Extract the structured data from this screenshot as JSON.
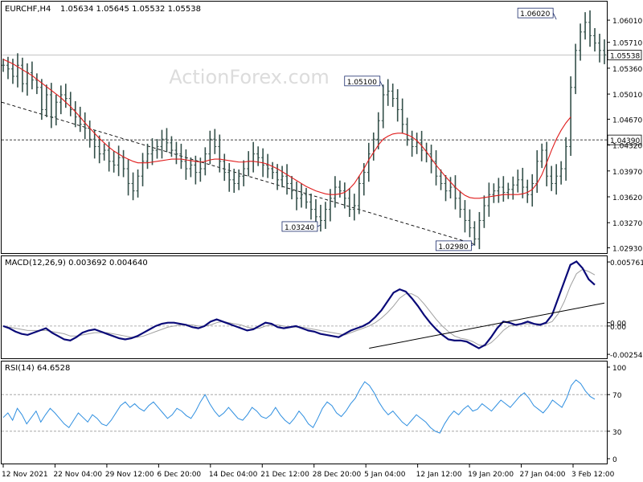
{
  "header": {
    "symbol": "EURCHF,H4",
    "ohlc": "1.05634 1.05645 1.05532 1.05538"
  },
  "watermark": "ActionForex.com",
  "colors": {
    "bars": "#34504a",
    "ma": "#e01c1c",
    "macd": "#0a0a78",
    "signal": "#a0a0a0",
    "rsi": "#2f8fe0",
    "trendline": "#000000",
    "text": "#000000"
  },
  "chart_data": [
    {
      "type": "line",
      "panel": "price",
      "ylim": [
        1.0287,
        1.0625
      ],
      "y_ticks": [
        "1.06010",
        "1.05710",
        "1.05360",
        "1.05010",
        "1.04670",
        "1.04320",
        "1.03970",
        "1.03620",
        "1.03270",
        "1.02930"
      ],
      "x_tick_labels": [
        "12 Nov 2021",
        "22 Nov 04:00",
        "29 Nov 12:00",
        "6 Dec 20:00",
        "14 Dec 04:00",
        "21 Dec 12:00",
        "28 Dec 20:00",
        "5 Jan 04:00",
        "12 Jan 12:00",
        "19 Jan 20:00",
        "27 Jan 04:00",
        "3 Feb 12:00"
      ],
      "current_price_label": "1.05538",
      "horizontal_line_label": "1.04390",
      "annotations": [
        {
          "text": "1.03240",
          "bar": 66,
          "value": 1.0324
        },
        {
          "text": "1.05100",
          "bar": 79,
          "value": 1.051
        },
        {
          "text": "1.02980",
          "bar": 98,
          "value": 1.0298
        },
        {
          "text": "1.06020",
          "bar": 115,
          "value": 1.0602
        }
      ],
      "price_series": [
        1.054,
        1.0535,
        1.0525,
        1.054,
        1.0515,
        1.053,
        1.052,
        1.051,
        1.048,
        1.05,
        1.047,
        1.049,
        1.05,
        1.0495,
        1.048,
        1.047,
        1.046,
        1.0455,
        1.044,
        1.043,
        1.042,
        1.0425,
        1.041,
        1.0405,
        1.0415,
        1.04,
        1.038,
        1.037,
        1.039,
        1.041,
        1.042,
        1.0425,
        1.043,
        1.044,
        1.0435,
        1.0425,
        1.042,
        1.041,
        1.04,
        1.0405,
        1.0395,
        1.04,
        1.042,
        1.044,
        1.043,
        1.041,
        1.0395,
        1.0385,
        1.038,
        1.039,
        1.04,
        1.041,
        1.042,
        1.0415,
        1.0405,
        1.04,
        1.0395,
        1.0385,
        1.039,
        1.038,
        1.037,
        1.036,
        1.0365,
        1.0355,
        1.0345,
        1.0335,
        1.033,
        1.0345,
        1.036,
        1.0375,
        1.037,
        1.036,
        1.0345,
        1.035,
        1.038,
        1.0395,
        1.042,
        1.044,
        1.0465,
        1.05,
        1.0505,
        1.0495,
        1.048,
        1.046,
        1.044,
        1.043,
        1.0435,
        1.0425,
        1.042,
        1.041,
        1.039,
        1.038,
        1.037,
        1.0375,
        1.036,
        1.0345,
        1.033,
        1.032,
        1.0305,
        1.033,
        1.035,
        1.0365,
        1.037,
        1.0375,
        1.0368,
        1.0372,
        1.0378,
        1.0385,
        1.0375,
        1.0365,
        1.038,
        1.041,
        1.0425,
        1.039,
        1.038,
        1.039,
        1.04,
        1.043,
        1.051,
        1.056,
        1.0585,
        1.0598,
        1.058,
        1.057,
        1.056,
        1.0554
      ],
      "ma_series": [
        1.0548,
        1.0545,
        1.0542,
        1.0538,
        1.0534,
        1.053,
        1.0526,
        1.0521,
        1.0516,
        1.0511,
        1.0506,
        1.0501,
        1.0496,
        1.049,
        1.0484,
        1.0477,
        1.047,
        1.0462,
        1.0455,
        1.0448,
        1.0441,
        1.0435,
        1.0429,
        1.0424,
        1.042,
        1.0416,
        1.0413,
        1.041,
        1.0408,
        1.0408,
        1.0408,
        1.0409,
        1.041,
        1.0411,
        1.0412,
        1.0413,
        1.0413,
        1.0413,
        1.0412,
        1.0411,
        1.041,
        1.0409,
        1.041,
        1.0412,
        1.0413,
        1.0413,
        1.0412,
        1.0411,
        1.041,
        1.0409,
        1.0409,
        1.041,
        1.041,
        1.0409,
        1.0408,
        1.0406,
        1.0403,
        1.04,
        1.0396,
        1.0392,
        1.0388,
        1.0384,
        1.038,
        1.0376,
        1.0373,
        1.037,
        1.0368,
        1.0366,
        1.0365,
        1.0365,
        1.0366,
        1.0368,
        1.0373,
        1.038,
        1.039,
        1.04,
        1.0412,
        1.0422,
        1.0432,
        1.044,
        1.0444,
        1.0447,
        1.0448,
        1.0448,
        1.0446,
        1.0443,
        1.0438,
        1.0431,
        1.0423,
        1.0414,
        1.0405,
        1.0397,
        1.0389,
        1.0382,
        1.0375,
        1.0369,
        1.0364,
        1.0361,
        1.036,
        1.036,
        1.0361,
        1.0362,
        1.0363,
        1.0364,
        1.0365,
        1.0365,
        1.0365,
        1.0365,
        1.0366,
        1.0368,
        1.0372,
        1.038,
        1.0392,
        1.0408,
        1.0425,
        1.044,
        1.0452,
        1.0462,
        1.047
      ]
    },
    {
      "type": "line",
      "panel": "macd",
      "title": "MACD(12,26,9) 0.003692 0.004640",
      "ylim": [
        -0.0029,
        0.0062
      ],
      "y_ticks": [
        "0.005761",
        "0.00",
        "0.00",
        "-0.002546"
      ],
      "macd_series": [
        0.0,
        -0.0002,
        -0.0005,
        -0.0007,
        -0.0008,
        -0.0006,
        -0.0004,
        -0.0002,
        -0.0006,
        -0.0009,
        -0.0012,
        -0.0013,
        -0.001,
        -0.0006,
        -0.0004,
        -0.0003,
        -0.0005,
        -0.0007,
        -0.0009,
        -0.0011,
        -0.0012,
        -0.0011,
        -0.0009,
        -0.0006,
        -0.0003,
        0.0,
        0.0002,
        0.0003,
        0.0003,
        0.0002,
        0.0001,
        -0.0001,
        -0.0002,
        0.0,
        0.0004,
        0.0006,
        0.0004,
        0.0002,
        0.0,
        -0.0002,
        -0.0004,
        -0.0003,
        0.0,
        0.0003,
        0.0002,
        -0.0001,
        -0.0002,
        -0.0001,
        0.0,
        -0.0002,
        -0.0004,
        -0.0005,
        -0.0007,
        -0.0008,
        -0.0009,
        -0.001,
        -0.0007,
        -0.0004,
        -0.0002,
        0.0,
        0.0003,
        0.0008,
        0.0014,
        0.0022,
        0.003,
        0.0033,
        0.0031,
        0.0025,
        0.0018,
        0.001,
        0.0003,
        -0.0003,
        -0.0008,
        -0.0012,
        -0.0013,
        -0.0013,
        -0.0014,
        -0.0017,
        -0.002,
        -0.0017,
        -0.001,
        -0.0002,
        0.0004,
        0.0003,
        0.0001,
        0.0002,
        0.0004,
        0.0002,
        0.0001,
        0.0003,
        0.001,
        0.0025,
        0.004,
        0.0055,
        0.0058,
        0.0052,
        0.0042,
        0.0037
      ],
      "signal_series": [
        0.0,
        -0.0001,
        -0.0002,
        -0.0003,
        -0.0004,
        -0.0004,
        -0.0004,
        -0.0004,
        -0.0005,
        -0.0006,
        -0.0007,
        -0.0009,
        -0.0009,
        -0.0008,
        -0.0007,
        -0.0006,
        -0.0006,
        -0.0006,
        -0.0007,
        -0.0008,
        -0.0009,
        -0.001,
        -0.001,
        -0.0009,
        -0.0007,
        -0.0005,
        -0.0003,
        -0.0001,
        0.0,
        0.0001,
        0.0001,
        0.0001,
        0.0,
        0.0,
        0.0001,
        0.0003,
        0.0004,
        0.0003,
        0.0002,
        0.0001,
        -0.0001,
        -0.0002,
        -0.0002,
        0.0,
        0.0001,
        0.0001,
        0.0,
        -0.0001,
        -0.0001,
        -0.0001,
        -0.0002,
        -0.0003,
        -0.0004,
        -0.0005,
        -0.0006,
        -0.0007,
        -0.0008,
        -0.0006,
        -0.0004,
        -0.0002,
        0.0,
        0.0003,
        0.0007,
        0.0012,
        0.0018,
        0.0025,
        0.0029,
        0.0029,
        0.0026,
        0.002,
        0.0013,
        0.0006,
        0.0,
        -0.0005,
        -0.0009,
        -0.0011,
        -0.0012,
        -0.0014,
        -0.0017,
        -0.0018,
        -0.0015,
        -0.001,
        -0.0004,
        0.0,
        0.0001,
        0.0002,
        0.0002,
        0.0002,
        0.0002,
        0.0002,
        0.0004,
        0.0011,
        0.0022,
        0.0036,
        0.0047,
        0.0051,
        0.0049,
        0.0046
      ],
      "trendline": [
        {
          "index": 60,
          "value": -0.002
        },
        {
          "index": 99,
          "value": 0.0012
        }
      ]
    },
    {
      "type": "line",
      "panel": "rsi",
      "title": "RSI(14) 64.6528",
      "ylim": [
        0,
        100
      ],
      "y_ticks": [
        "100",
        "70",
        "30",
        "0"
      ],
      "levels": [
        70,
        30
      ],
      "rsi_series": [
        45,
        50,
        42,
        55,
        48,
        38,
        45,
        52,
        40,
        48,
        55,
        50,
        44,
        38,
        34,
        42,
        50,
        45,
        40,
        48,
        44,
        38,
        36,
        42,
        50,
        58,
        62,
        56,
        60,
        55,
        52,
        58,
        62,
        56,
        50,
        44,
        48,
        55,
        52,
        47,
        44,
        52,
        62,
        70,
        60,
        52,
        46,
        50,
        56,
        50,
        44,
        42,
        48,
        56,
        52,
        46,
        44,
        48,
        56,
        48,
        42,
        38,
        44,
        52,
        46,
        38,
        34,
        44,
        55,
        62,
        58,
        50,
        46,
        52,
        60,
        66,
        76,
        84,
        80,
        72,
        62,
        54,
        48,
        52,
        46,
        40,
        36,
        42,
        48,
        44,
        40,
        34,
        30,
        28,
        38,
        46,
        52,
        48,
        54,
        58,
        52,
        54,
        60,
        56,
        52,
        58,
        64,
        60,
        56,
        62,
        68,
        72,
        66,
        58,
        54,
        50,
        56,
        64,
        60,
        56,
        66,
        80,
        86,
        82,
        74,
        68,
        65
      ]
    }
  ]
}
